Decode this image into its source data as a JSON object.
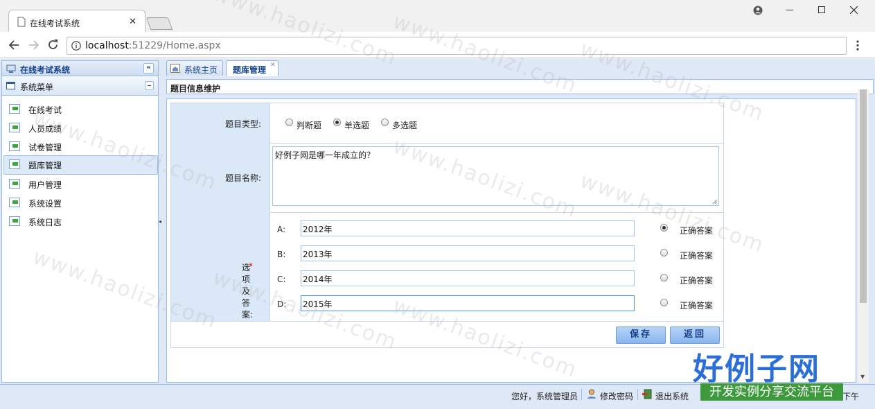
{
  "browser": {
    "tab_title": "在线考试系统",
    "tab_close": "✕",
    "url_host": "localhost",
    "url_rest": ":51229/Home.aspx",
    "window_controls": [
      "person-icon",
      "minimize-icon",
      "maximize-icon",
      "close-icon"
    ]
  },
  "sidebar": {
    "title": "在线考试系统",
    "section": "系统菜单",
    "items": [
      {
        "label": "在线考试"
      },
      {
        "label": "人员成绩"
      },
      {
        "label": "试卷管理"
      },
      {
        "label": "题库管理",
        "selected": true
      },
      {
        "label": "用户管理"
      },
      {
        "label": "系统设置"
      },
      {
        "label": "系统日志"
      }
    ]
  },
  "tabs": [
    {
      "label": "系统主页"
    },
    {
      "label": "题库管理",
      "active": true
    }
  ],
  "panel": {
    "title": "题目信息维护"
  },
  "form": {
    "type_label": "题目类型:",
    "type_options": [
      {
        "label": "判断题",
        "checked": false
      },
      {
        "label": "单选题",
        "checked": true
      },
      {
        "label": "多选题",
        "checked": false
      }
    ],
    "name_label": "题目名称:",
    "name_value": "好例子网是哪一年成立的？",
    "options_required_mark": "*",
    "options_label": "选项及答案:",
    "options": [
      {
        "letter": "A:",
        "value": "2012年",
        "correct": true,
        "correct_label": "正确答案"
      },
      {
        "letter": "B:",
        "value": "2013年",
        "correct": false,
        "correct_label": "正确答案"
      },
      {
        "letter": "C:",
        "value": "2014年",
        "correct": false,
        "correct_label": "正确答案"
      },
      {
        "letter": "D:",
        "value": "2015年",
        "correct": false,
        "correct_label": "正确答案"
      }
    ],
    "save_label": "保存",
    "back_label": "返回"
  },
  "status": {
    "greeting": "您好，系统管理员",
    "change_password": "修改密码",
    "logout": "退出系统",
    "time_suffix": "下午"
  },
  "watermark": {
    "text": "www.haolizi.com",
    "logo_title": "好例子网",
    "logo_subtitle": "开发实例分享交流平台"
  },
  "colors": {
    "accent": "#15428b",
    "panel_border": "#99bbe8",
    "label_bg": "#dbe8f7"
  }
}
